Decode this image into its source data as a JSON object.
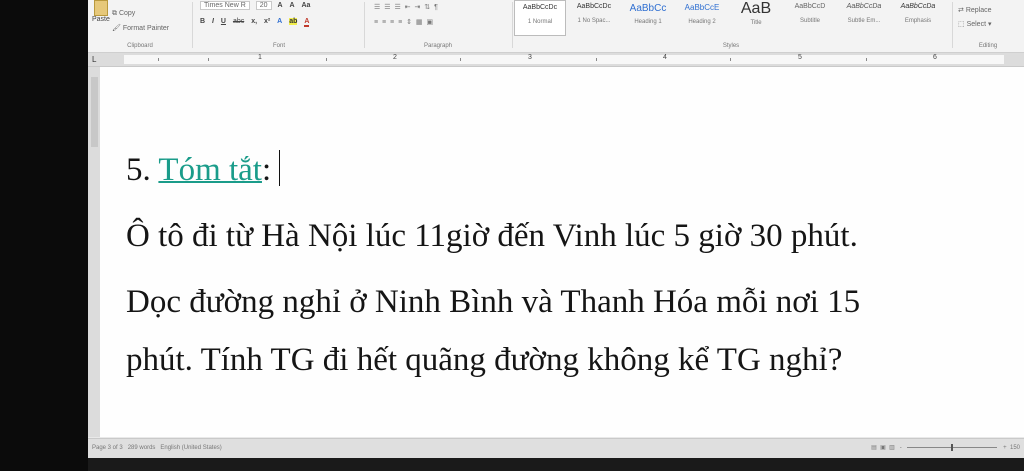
{
  "ribbon": {
    "clipboard": {
      "paste": "Paste",
      "copy": "Copy",
      "format_painter": "Format Painter",
      "label": "Clipboard"
    },
    "font": {
      "name": "Times New R",
      "size": "20",
      "label": "Font",
      "grow": "A",
      "shrink": "A",
      "case": "Aa",
      "subscript": "x,",
      "superscript": "x²",
      "strike": "abc"
    },
    "paragraph": {
      "label": "Paragraph"
    },
    "styles": {
      "label": "Styles",
      "items": [
        {
          "sample": "AaBbCcDc",
          "name": "1 Normal"
        },
        {
          "sample": "AaBbCcDc",
          "name": "1 No Spac..."
        },
        {
          "sample": "AaBbCc",
          "name": "Heading 1"
        },
        {
          "sample": "AaBbCcE",
          "name": "Heading 2"
        },
        {
          "sample": "AaB",
          "name": "Title"
        },
        {
          "sample": "AaBbCcD",
          "name": "Subtitle"
        },
        {
          "sample": "AaBbCcDa",
          "name": "Subtle Em..."
        },
        {
          "sample": "AaBbCcDa",
          "name": "Emphasis"
        }
      ]
    },
    "editing": {
      "replace": "Replace",
      "select": "Select",
      "label": "Editing"
    }
  },
  "ruler": {
    "numbers": [
      "1",
      "2",
      "3",
      "4",
      "5",
      "6"
    ]
  },
  "document": {
    "heading_number": "5.",
    "heading_link": "Tóm tắt",
    "heading_colon": ":",
    "line1": "Ô tô đi từ Hà Nội lúc 11giờ đến Vinh lúc 5 giờ 30 phút.",
    "line2": "Dọc đường nghỉ ở Ninh Bình và Thanh Hóa mỗi nơi 15",
    "line3": "phút. Tính TG đi hết quãng đường không kể TG nghỉ?"
  },
  "status": {
    "page": "Page 3 of 3",
    "words": "289 words",
    "language": "English (United States)",
    "zoom_minus": "-",
    "zoom_plus": "+",
    "zoom": "150"
  },
  "colors": {
    "link": "#1a9c8a",
    "ribbon": "#f3f3f3",
    "page": "#fefefe"
  }
}
